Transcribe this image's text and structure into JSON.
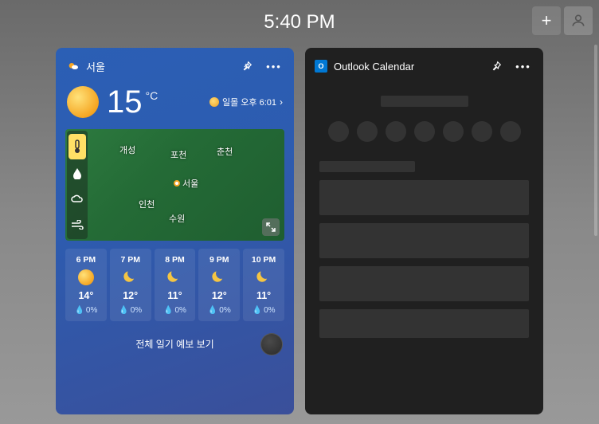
{
  "time": "5:40 PM",
  "weather": {
    "location": "서울",
    "temp": "15",
    "unit": "°C",
    "sunset_label": "일몰 오후 6:01",
    "full_forecast_label": "전체 일기 예보 보기",
    "map": {
      "labels": {
        "gaeseong": "개성",
        "pocheon": "포천",
        "chuncheon": "춘천",
        "seoul": "서울",
        "incheon": "인천",
        "suwon": "수원"
      }
    },
    "hourly": [
      {
        "time": "6 PM",
        "icon": "sun",
        "temp": "14°",
        "rain": "0%"
      },
      {
        "time": "7 PM",
        "icon": "moon",
        "temp": "12°",
        "rain": "0%"
      },
      {
        "time": "8 PM",
        "icon": "moon",
        "temp": "11°",
        "rain": "0%"
      },
      {
        "time": "9 PM",
        "icon": "moon",
        "temp": "12°",
        "rain": "0%"
      },
      {
        "time": "10 PM",
        "icon": "moon",
        "temp": "11°",
        "rain": "0%"
      }
    ]
  },
  "outlook": {
    "title": "Outlook Calendar"
  }
}
